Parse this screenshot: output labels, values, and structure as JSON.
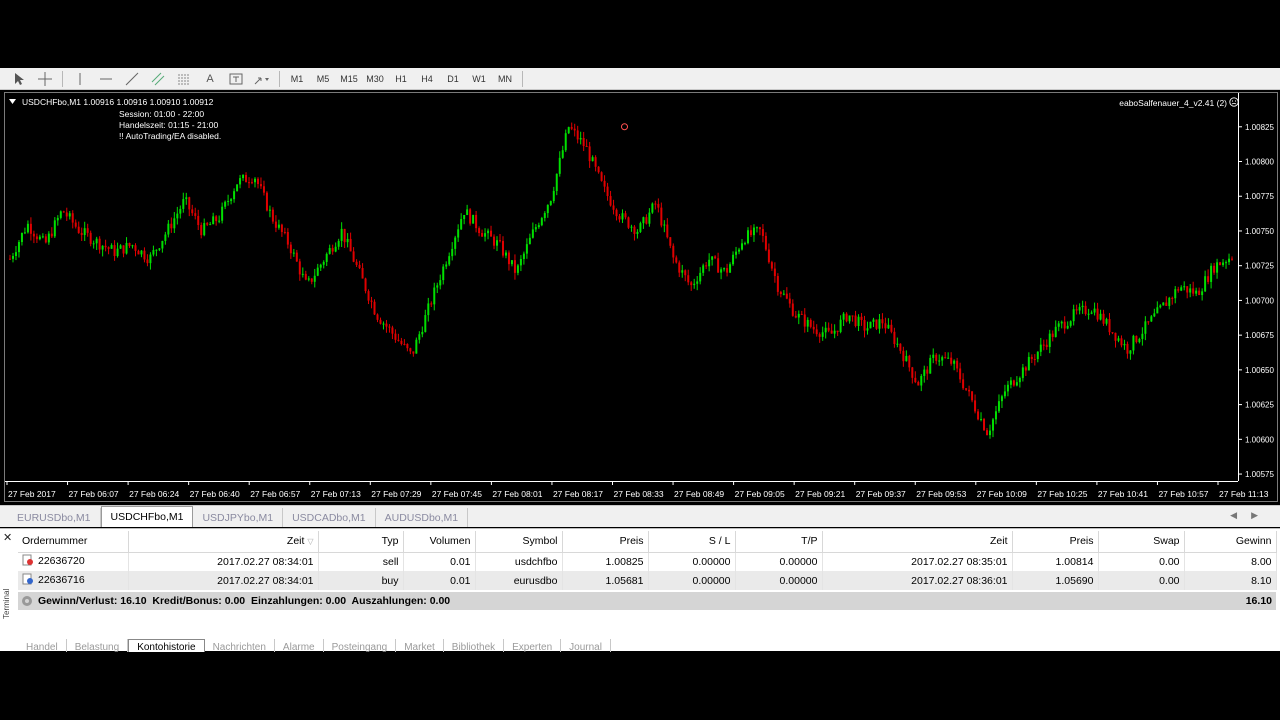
{
  "toolbar": {
    "timeframes": [
      "M1",
      "M5",
      "M15",
      "M30",
      "H1",
      "H4",
      "D1",
      "W1",
      "MN"
    ]
  },
  "chart": {
    "symbol_line": "USDCHFbo,M1  1.00916 1.00916 1.00910 1.00912",
    "session": "Session:        01:00 - 22:00",
    "handelszeit": "Handelszeit: 01:15 - 21:00",
    "autotrading": "!! AutoTrading/EA disabled.",
    "ea_name": "eaboSalfenauer_4_v2.41 (2)"
  },
  "chart_data": {
    "type": "candlestick",
    "symbol": "USDCHFbo",
    "timeframe": "M1",
    "ylim": [
      1.0057,
      1.00845
    ],
    "y_ticks": [
      "1.00825",
      "1.00800",
      "1.00775",
      "1.00750",
      "1.00725",
      "1.00700",
      "1.00675",
      "1.00650",
      "1.00625",
      "1.00600",
      "1.00575"
    ],
    "x_ticks": [
      "27 Feb 2017",
      "27 Feb 06:07",
      "27 Feb 06:24",
      "27 Feb 06:40",
      "27 Feb 06:57",
      "27 Feb 07:13",
      "27 Feb 07:29",
      "27 Feb 07:45",
      "27 Feb 08:01",
      "27 Feb 08:17",
      "27 Feb 08:33",
      "27 Feb 08:49",
      "27 Feb 09:05",
      "27 Feb 09:21",
      "27 Feb 09:37",
      "27 Feb 09:53",
      "27 Feb 10:09",
      "27 Feb 10:25",
      "27 Feb 10:41",
      "27 Feb 10:57",
      "27 Feb 11:13"
    ],
    "close_path": [
      1.0073,
      1.00755,
      1.0074,
      1.00765,
      1.0075,
      1.00742,
      1.00735,
      1.0074,
      1.0073,
      1.0075,
      1.00772,
      1.0075,
      1.0076,
      1.00785,
      1.0079,
      1.0076,
      1.0074,
      1.0071,
      1.0073,
      1.0075,
      1.0072,
      1.0069,
      1.00675,
      1.0066,
      1.00695,
      1.0073,
      1.00765,
      1.0075,
      1.0074,
      1.0072,
      1.0075,
      1.00775,
      1.00825,
      1.0081,
      1.0078,
      1.0076,
      1.0075,
      1.0077,
      1.0073,
      1.0071,
      1.0073,
      1.0072,
      1.00745,
      1.0075,
      1.0071,
      1.0069,
      1.0068,
      1.00675,
      1.0069,
      1.0068,
      1.00685,
      1.00665,
      1.0064,
      1.0066,
      1.00655,
      1.0063,
      1.00605,
      1.00635,
      1.0065,
      1.00665,
      1.0068,
      1.0069,
      1.00695,
      1.0068,
      1.00665,
      1.0068,
      1.00695,
      1.0071,
      1.00705,
      1.00725,
      1.00732
    ],
    "open_marker_price": 1.00825,
    "bull_color": "#00e000",
    "bear_color": "#e00000",
    "background": "#000000",
    "grid": false
  },
  "symbol_tabs": {
    "tabs": [
      "EURUSDbo,M1",
      "USDCHFbo,M1",
      "USDJPYbo,M1",
      "USDCADbo,M1",
      "AUDUSDbo,M1"
    ],
    "active_index": 1
  },
  "terminal": {
    "columns": {
      "order": "Ordernummer",
      "time": "Zeit",
      "type": "Typ",
      "volume": "Volumen",
      "symbol": "Symbol",
      "price": "Preis",
      "sl": "S / L",
      "tp": "T/P",
      "close_time": "Zeit",
      "close_price": "Preis",
      "swap": "Swap",
      "profit": "Gewinn"
    },
    "rows": [
      {
        "order": "22636720",
        "time": "2017.02.27 08:34:01",
        "type": "sell",
        "volume": "0.01",
        "symbol": "usdchfbo",
        "price": "1.00825",
        "sl": "0.00000",
        "tp": "0.00000",
        "close_time": "2017.02.27 08:35:01",
        "close_price": "1.00814",
        "swap": "0.00",
        "profit": "8.00"
      },
      {
        "order": "22636716",
        "time": "2017.02.27 08:34:01",
        "type": "buy",
        "volume": "0.01",
        "symbol": "eurusdbo",
        "price": "1.05681",
        "sl": "0.00000",
        "tp": "0.00000",
        "close_time": "2017.02.27 08:36:01",
        "close_price": "1.05690",
        "swap": "0.00",
        "profit": "8.10"
      }
    ],
    "summary": {
      "text": "Gewinn/Verlust: 16.10  Kredit/Bonus: 0.00  Einzahlungen: 0.00  Auszahlungen: 0.00",
      "total": "16.10"
    },
    "side_label": "Terminal",
    "tabs": [
      "Handel",
      "Belastung",
      "Kontohistorie",
      "Nachrichten",
      "Alarme",
      "Posteingang",
      "Market",
      "Bibliothek",
      "Experten",
      "Journal"
    ],
    "active_tab_index": 2
  }
}
